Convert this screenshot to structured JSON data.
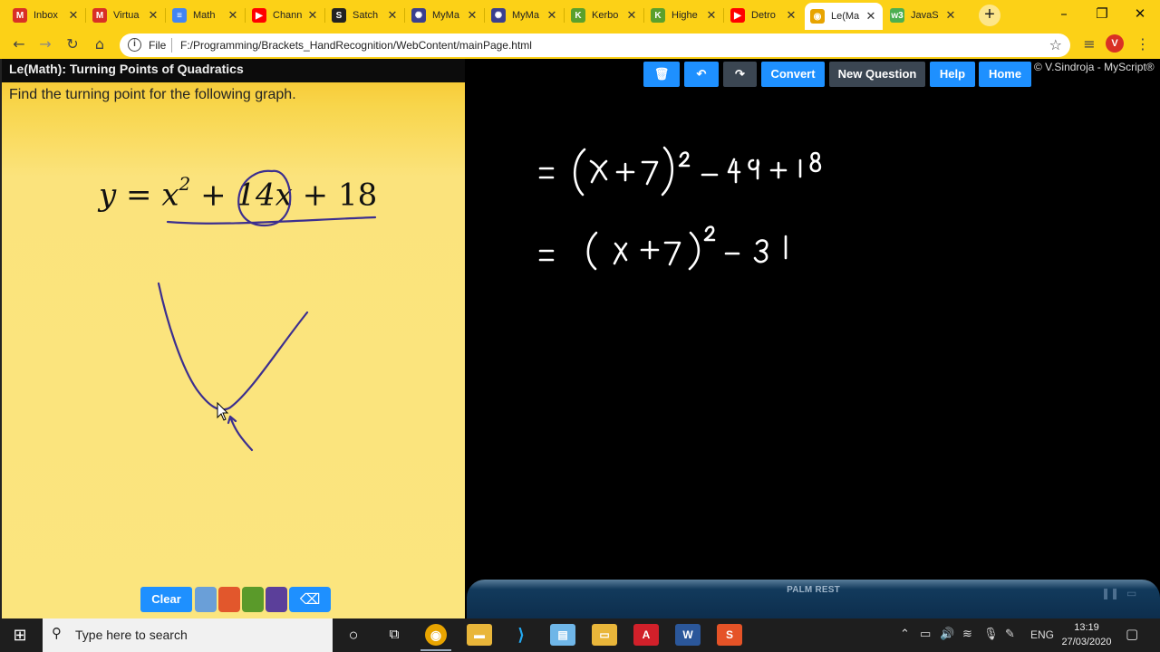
{
  "browser": {
    "tabs": [
      {
        "title": "Inbox",
        "favicon": "gmail-icon",
        "color": "#d93025",
        "glyph": "M",
        "active": false
      },
      {
        "title": "Virtua",
        "favicon": "gmail-icon",
        "color": "#d93025",
        "glyph": "M",
        "active": false
      },
      {
        "title": "Math",
        "favicon": "docs-icon",
        "color": "#4285f4",
        "glyph": "≡",
        "active": false
      },
      {
        "title": "Chann",
        "favicon": "youtube-icon",
        "color": "#ff0000",
        "glyph": "▶",
        "active": false
      },
      {
        "title": "Satch",
        "favicon": "satchel-icon",
        "color": "#222222",
        "glyph": "S",
        "active": false
      },
      {
        "title": "MyMa",
        "favicon": "mymaths-icon",
        "color": "#3a3f8f",
        "glyph": "✺",
        "active": false
      },
      {
        "title": "MyMa",
        "favicon": "mymaths-icon",
        "color": "#3a3f8f",
        "glyph": "✺",
        "active": false
      },
      {
        "title": "Kerbo",
        "favicon": "kerboodle-icon",
        "color": "#5aa02c",
        "glyph": "K",
        "active": false
      },
      {
        "title": "Highe",
        "favicon": "kerboodle-icon",
        "color": "#5aa02c",
        "glyph": "K",
        "active": false
      },
      {
        "title": "Detro",
        "favicon": "youtube-icon",
        "color": "#ff0000",
        "glyph": "▶",
        "active": false
      },
      {
        "title": "Le(Ma",
        "favicon": "chrome-icon",
        "color": "#e8a400",
        "glyph": "◉",
        "active": true
      },
      {
        "title": "JavaS",
        "favicon": "w3schools-icon",
        "color": "#4caf50",
        "glyph": "w3",
        "active": false
      }
    ],
    "url_scheme": "File",
    "url": "F:/Programming/Brackets_HandRecognition/WebContent/mainPage.html",
    "profile_initial": "V"
  },
  "app": {
    "title": "Le(Math): Turning Points of Quadratics",
    "prompt": "Find the turning point for the following graph.",
    "equation": {
      "lhs": "y",
      "eq": "=",
      "x2": "x",
      "exp": "2",
      "plus1": "+",
      "linear": "14x",
      "plus2": "+",
      "constant": "18"
    },
    "clear_label": "Clear",
    "pen_colors": [
      "#6a9fd8",
      "#e2572c",
      "#5a9a2a",
      "#5b3f9a"
    ],
    "eraser_icon": "eraser-icon"
  },
  "workspace": {
    "toolbar": {
      "delete_icon": "trash-icon",
      "undo_icon": "undo-icon",
      "redo_icon": "redo-icon",
      "convert_label": "Convert",
      "new_question_label": "New Question",
      "help_label": "Help",
      "home_label": "Home"
    },
    "copyright": "© V.Sindroja - MyScript®",
    "handwritten_lines": [
      "= (x + 7)² − 49 + 18",
      "= (x + 7)² − 31"
    ],
    "palm_rest_label": "PALM REST"
  },
  "taskbar": {
    "search_placeholder": "Type here to search",
    "language": "ENG",
    "time": "13:19",
    "date": "27/03/2020",
    "apps": [
      "cortana-icon",
      "task-view-icon",
      "chrome-icon",
      "file-explorer-icon",
      "vscode-icon",
      "notepad-icon",
      "folder-icon",
      "acrobat-icon",
      "word-icon",
      "slides-icon"
    ]
  }
}
